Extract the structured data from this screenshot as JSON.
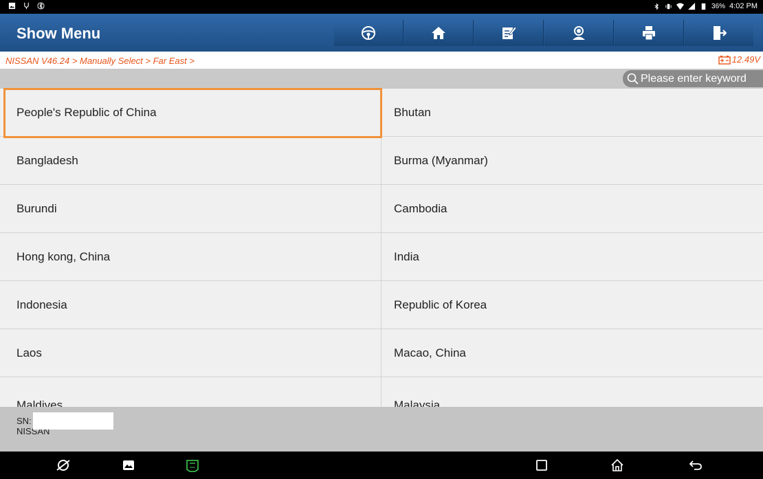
{
  "statusbar": {
    "battery_percent": "36%",
    "time": "4:02 PM"
  },
  "toolbar": {
    "title": "Show Menu"
  },
  "breadcrumb": "NISSAN V46.24 > Manually Select > Far East >",
  "voltage": "12.49V",
  "search": {
    "placeholder": "Please enter keyword"
  },
  "countries": [
    [
      "People's Republic of China",
      "Bhutan"
    ],
    [
      "Bangladesh",
      "Burma (Myanmar)"
    ],
    [
      "Burundi",
      "Cambodia"
    ],
    [
      "Hong kong, China",
      "India"
    ],
    [
      "Indonesia",
      "Republic of Korea"
    ],
    [
      "Laos",
      "Macao, China"
    ],
    [
      "Maldives",
      "Malaysia"
    ]
  ],
  "selected_item": "People's Republic of China",
  "footer": {
    "sn_label": "SN:",
    "brand": "NISSAN"
  },
  "colors": {
    "toolbar_blue": "#2a5f9e",
    "breadcrumb_orange": "#e8541a",
    "selection_orange": "#f0923a",
    "vci_green": "#3bb54a"
  }
}
